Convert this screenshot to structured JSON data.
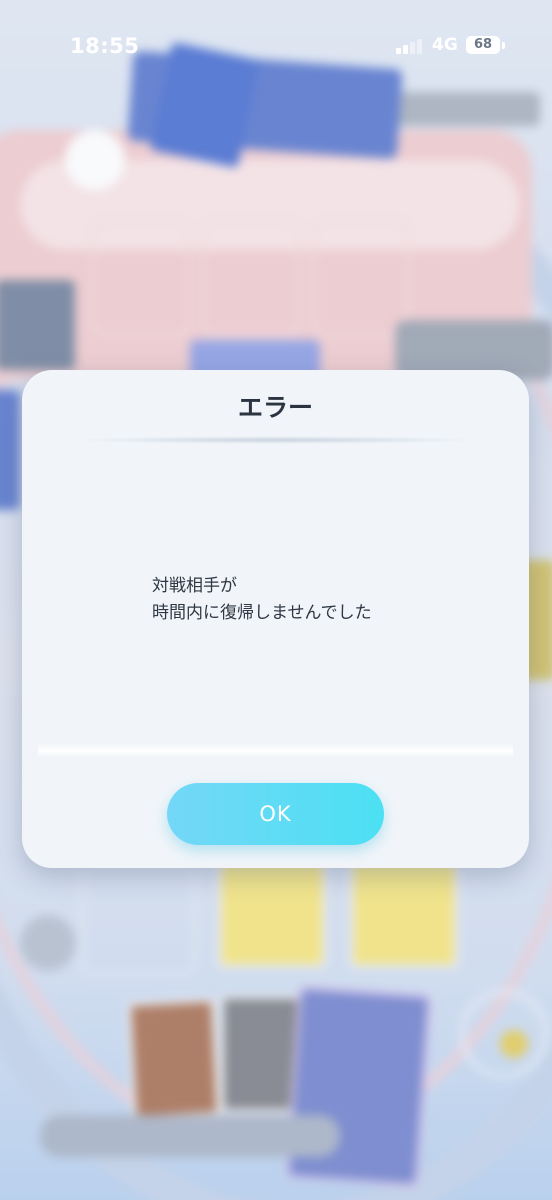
{
  "status_bar": {
    "time": "18:55",
    "network": "4G",
    "battery": "68",
    "signal_bars_active": 2,
    "signal_bars_total": 4
  },
  "dialog": {
    "title": "エラー",
    "message_lines": [
      "対戦相手が",
      "時間内に復帰しませんでした"
    ],
    "ok_label": "OK"
  },
  "colors": {
    "ok_button": "#4be0f3",
    "dialog_bg": "#f1f5f9",
    "title_text": "#2c3442"
  }
}
